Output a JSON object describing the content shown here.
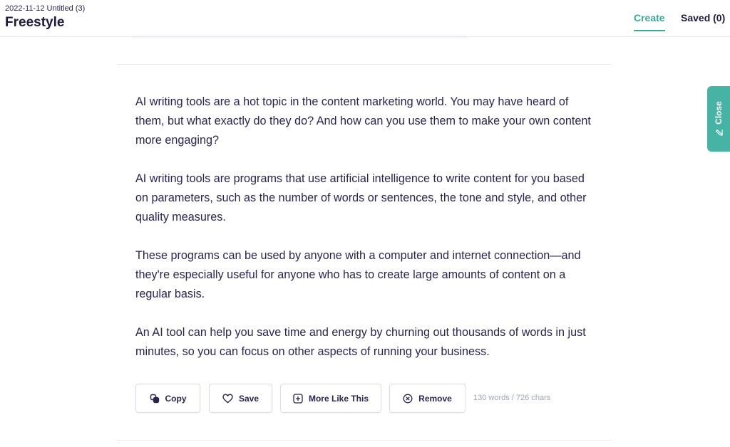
{
  "header": {
    "doc_meta": "2022-11-12 Untitled (3)",
    "title": "Freestyle",
    "tabs": [
      {
        "label": "Create",
        "active": true
      },
      {
        "label": "Saved (0)",
        "active": false
      }
    ]
  },
  "content": {
    "paragraphs": [
      "AI writing tools are a hot topic in the content marketing world. You may have heard of them, but what exactly do they do? And how can you use them to make your own content more engaging?",
      "AI writing tools are programs that use artificial intelligence to write content for you based on parameters, such as the number of words or sentences, the tone and style, and other quality measures.",
      "These programs can be used by anyone with a computer and internet connection—and they're especially useful for anyone who has to create large amounts of content on a regular basis.",
      "An AI tool can help you save time and energy by churning out thousands of words in just minutes, so you can focus on other aspects of running your business."
    ]
  },
  "actions": {
    "copy_label": "Copy",
    "save_label": "Save",
    "more_label": "More Like This",
    "remove_label": "Remove",
    "counts": "130 words / 726 chars"
  },
  "side_tab": {
    "close_label": "Close"
  },
  "icons": {
    "copy": "copy-icon",
    "save": "heart-icon",
    "more": "plus-square-icon",
    "remove": "x-circle-icon",
    "close": "pencil-icon"
  },
  "colors": {
    "accent": "#3aa89a",
    "side_tab": "#47b3a4",
    "text": "#2a2450",
    "muted": "#a0a3b4"
  }
}
